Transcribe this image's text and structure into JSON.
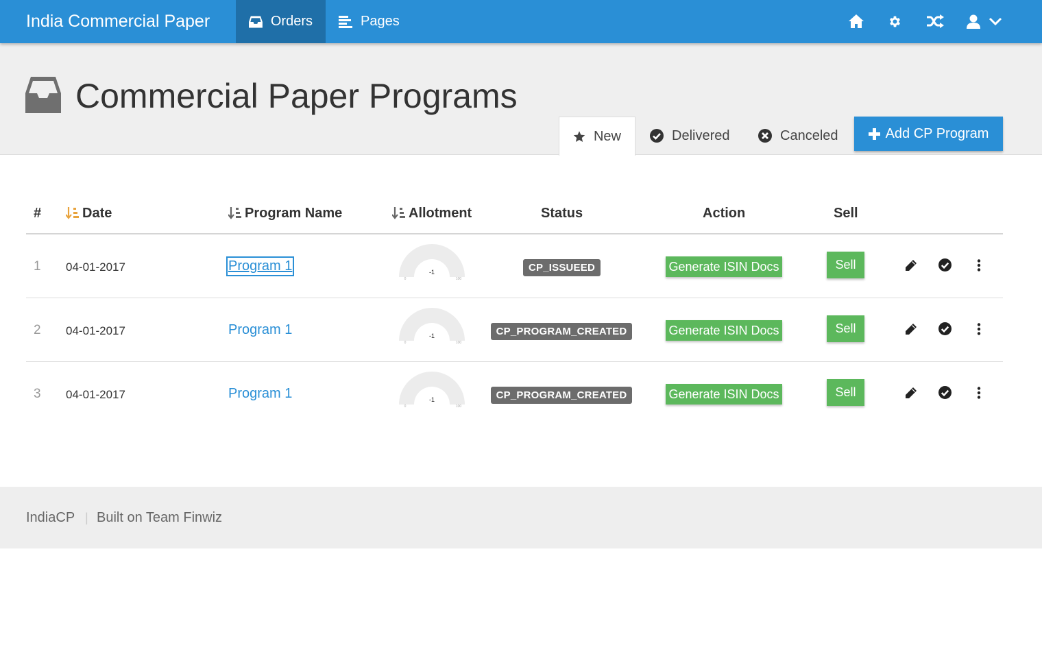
{
  "app": {
    "title": "India Commercial Paper"
  },
  "nav": {
    "items": [
      {
        "label": "Orders",
        "icon": "inbox-icon",
        "active": true
      },
      {
        "label": "Pages",
        "icon": "list-icon",
        "active": false
      }
    ],
    "right_icons": [
      "home-icon",
      "gear-icon",
      "shuffle-icon",
      "user-icon",
      "chevron-down-icon"
    ]
  },
  "page": {
    "title": "Commercial Paper Programs",
    "icon": "inbox-icon"
  },
  "tabs": [
    {
      "label": "New",
      "icon": "star-icon",
      "active": true
    },
    {
      "label": "Delivered",
      "icon": "check-circle-icon",
      "active": false
    },
    {
      "label": "Canceled",
      "icon": "x-circle-icon",
      "active": false
    }
  ],
  "add_button": {
    "label": "Add CP Program"
  },
  "table": {
    "headers": {
      "index": "#",
      "date": "Date",
      "program": "Program Name",
      "allotment": "Allotment",
      "status": "Status",
      "action": "Action",
      "sell": "Sell"
    },
    "rows": [
      {
        "index": "1",
        "date": "04-01-2017",
        "program": "Program 1",
        "gauge_value": "-1",
        "gauge_min": "0",
        "gauge_max": "100",
        "status": "CP_ISSUEED",
        "action": "Generate ISIN Docs",
        "sell": "Sell"
      },
      {
        "index": "2",
        "date": "04-01-2017",
        "program": "Program 1",
        "gauge_value": "-1",
        "gauge_min": "0",
        "gauge_max": "100",
        "status": "CP_PROGRAM_CREATED",
        "action": "Generate ISIN Docs",
        "sell": "Sell"
      },
      {
        "index": "3",
        "date": "04-01-2017",
        "program": "Program 1",
        "gauge_value": "-1",
        "gauge_min": "0",
        "gauge_max": "100",
        "status": "CP_PROGRAM_CREATED",
        "action": "Generate ISIN Docs",
        "sell": "Sell"
      }
    ]
  },
  "footer": {
    "brand": "IndiaCP",
    "separator": "|",
    "built": "Built on Team Finwiz"
  },
  "colors": {
    "primary": "#2a8fd6",
    "success": "#5cb85c",
    "badge": "#6c6c6c",
    "sort_active": "#e8a33d"
  }
}
